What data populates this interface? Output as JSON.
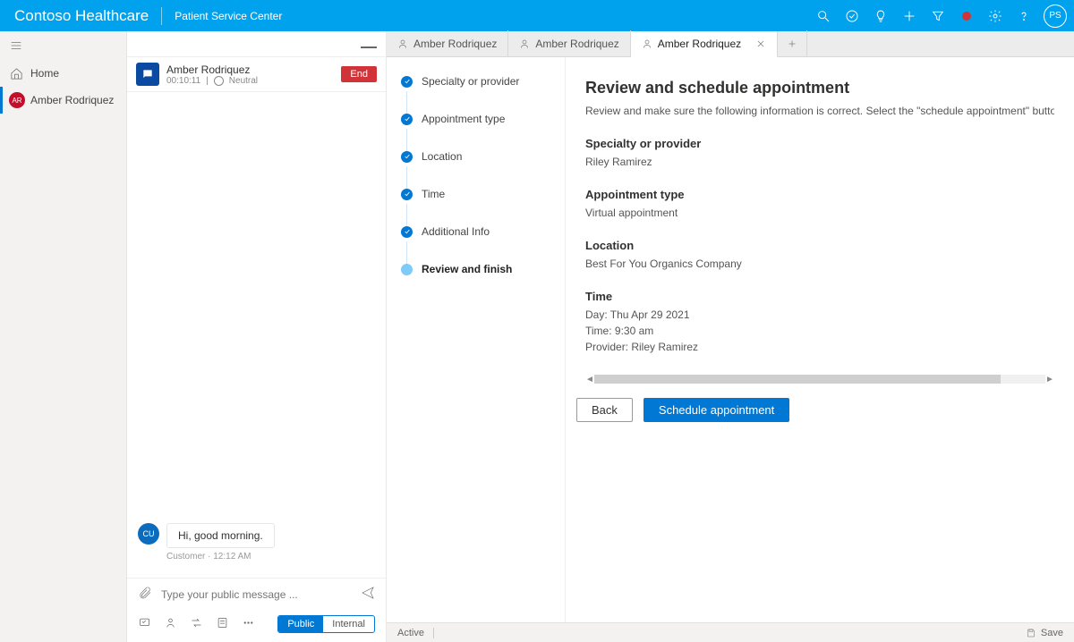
{
  "header": {
    "brand": "Contoso Healthcare",
    "suite": "Patient Service Center",
    "avatar_initials": "PS"
  },
  "rail": {
    "home": "Home",
    "active_patient": "Amber Rodriquez",
    "active_initials": "AR"
  },
  "session": {
    "name": "Amber Rodriquez",
    "timer": "00:10:11",
    "sentiment": "Neutral",
    "end_label": "End"
  },
  "chat": {
    "bubble_initials": "CU",
    "message": "Hi, good morning.",
    "meta": "Customer · 12:12 AM",
    "placeholder": "Type your public message ...",
    "public_label": "Public",
    "internal_label": "Internal"
  },
  "tabs": {
    "t1": "Amber Rodriquez",
    "t2": "Amber Rodriquez",
    "t3": "Amber Rodriquez"
  },
  "steps": {
    "s1": "Specialty or provider",
    "s2": "Appointment type",
    "s3": "Location",
    "s4": "Time",
    "s5": "Additional Info",
    "s6": "Review and finish"
  },
  "review": {
    "title": "Review and schedule appointment",
    "description": "Review and make sure the following information is correct. Select the \"schedule appointment\" button below to book the ap",
    "specialty_label": "Specialty or provider",
    "specialty_value": "Riley Ramirez",
    "type_label": "Appointment type",
    "type_value": "Virtual appointment",
    "location_label": "Location",
    "location_value": "Best For You Organics Company",
    "time_label": "Time",
    "time_value_day": "Day: Thu Apr 29 2021",
    "time_value_time": "Time: 9:30 am",
    "time_value_provider": "Provider: Riley Ramirez",
    "back_label": "Back",
    "schedule_label": "Schedule appointment"
  },
  "status": {
    "state": "Active",
    "save": "Save"
  }
}
